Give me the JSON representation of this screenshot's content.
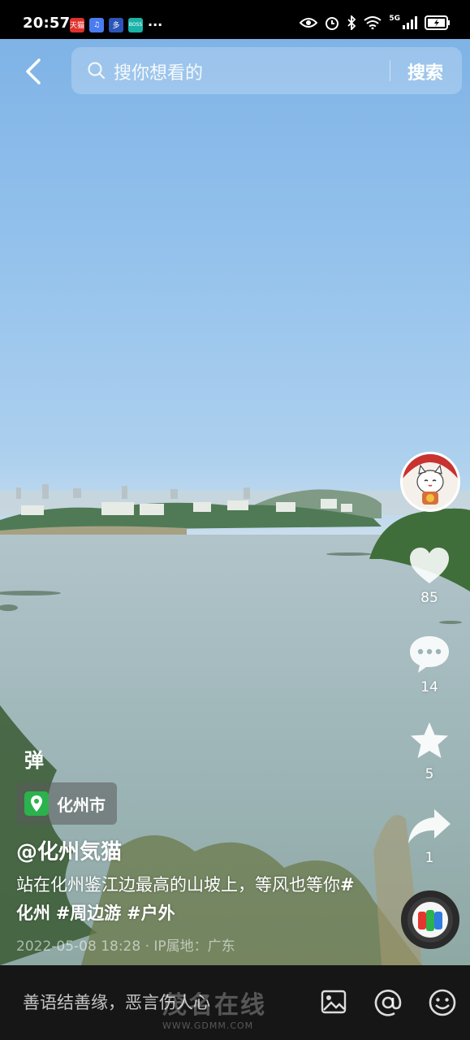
{
  "status_bar": {
    "time": "20:57",
    "network": "5G",
    "apps": [
      {
        "icon": "tmall-icon",
        "label": "天猫",
        "color": "#e0302b"
      },
      {
        "icon": "music-app-icon",
        "label": "♫",
        "color": "#4a7cf0"
      },
      {
        "icon": "app-icon",
        "label": "多",
        "color": "#2c55b7"
      },
      {
        "icon": "boss-zhipin-icon",
        "label": "BOSS",
        "color": "#1bb3a8"
      }
    ],
    "more": "···"
  },
  "header": {
    "search_placeholder": "搜你想看的",
    "search_button": "搜索"
  },
  "rail": {
    "likes": "85",
    "comments": "14",
    "favorites": "5",
    "shares": "1"
  },
  "video": {
    "danmu_label": "弹",
    "location": "化州市",
    "author": "@化州気猫",
    "caption_text": "站在化州鉴江边最高的山坡上，等风也等你",
    "hashtags": [
      "#化州",
      "#周边游",
      "#户外"
    ],
    "meta": "2022-05-08 18:28 · IP属地：广东"
  },
  "bottom": {
    "comment_placeholder": "善语结善缘，恶言伤人心"
  },
  "watermark": {
    "text": "茂名在线",
    "url": "WWW.GDMM.COM"
  },
  "colors": {
    "sky": "#93c1ec",
    "water": "#9db4b6",
    "location_pin": "#2bb24c"
  }
}
